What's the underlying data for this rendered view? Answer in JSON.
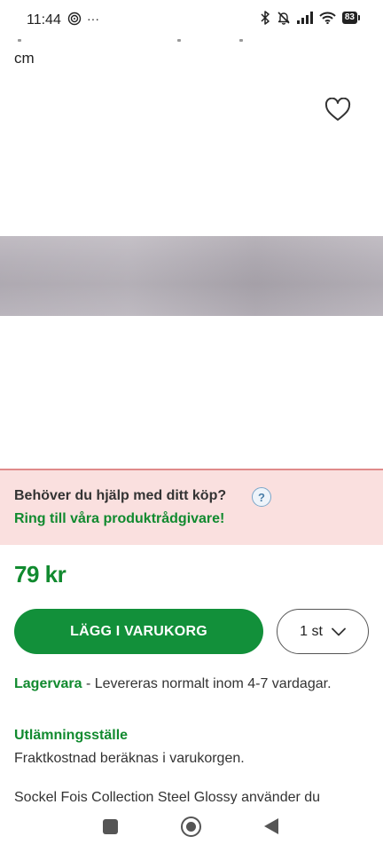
{
  "status_bar": {
    "time": "11:44",
    "more": "···",
    "battery": "83"
  },
  "page": {
    "cut_text": "cm"
  },
  "help": {
    "question": "Behöver du hjälp med ditt köp?",
    "icon_text": "?",
    "link": "Ring till våra produktrådgivare!"
  },
  "product": {
    "price": "79 kr",
    "add_to_cart_label": "LÄGG I VARUKORG",
    "quantity": "1 st",
    "stock_label": "Lagervara",
    "stock_text": " - Levereras normalt inom 4-7 vardagar.",
    "pickup_title": "Utlämningsställe",
    "pickup_text": "Fraktkostnad beräknas i varukorgen.",
    "description_partial": "Sockel Fois Collection Steel Glossy använder du"
  },
  "colors": {
    "brand_green": "#12903a",
    "help_bg": "#fae0df"
  },
  "icons": [
    "focus-icon",
    "bluetooth-icon",
    "muted-bell-icon",
    "signal-icon",
    "wifi-icon",
    "battery-icon",
    "heart-icon",
    "help-icon",
    "chevron-down-icon",
    "recent-apps-icon",
    "home-icon",
    "back-icon"
  ]
}
